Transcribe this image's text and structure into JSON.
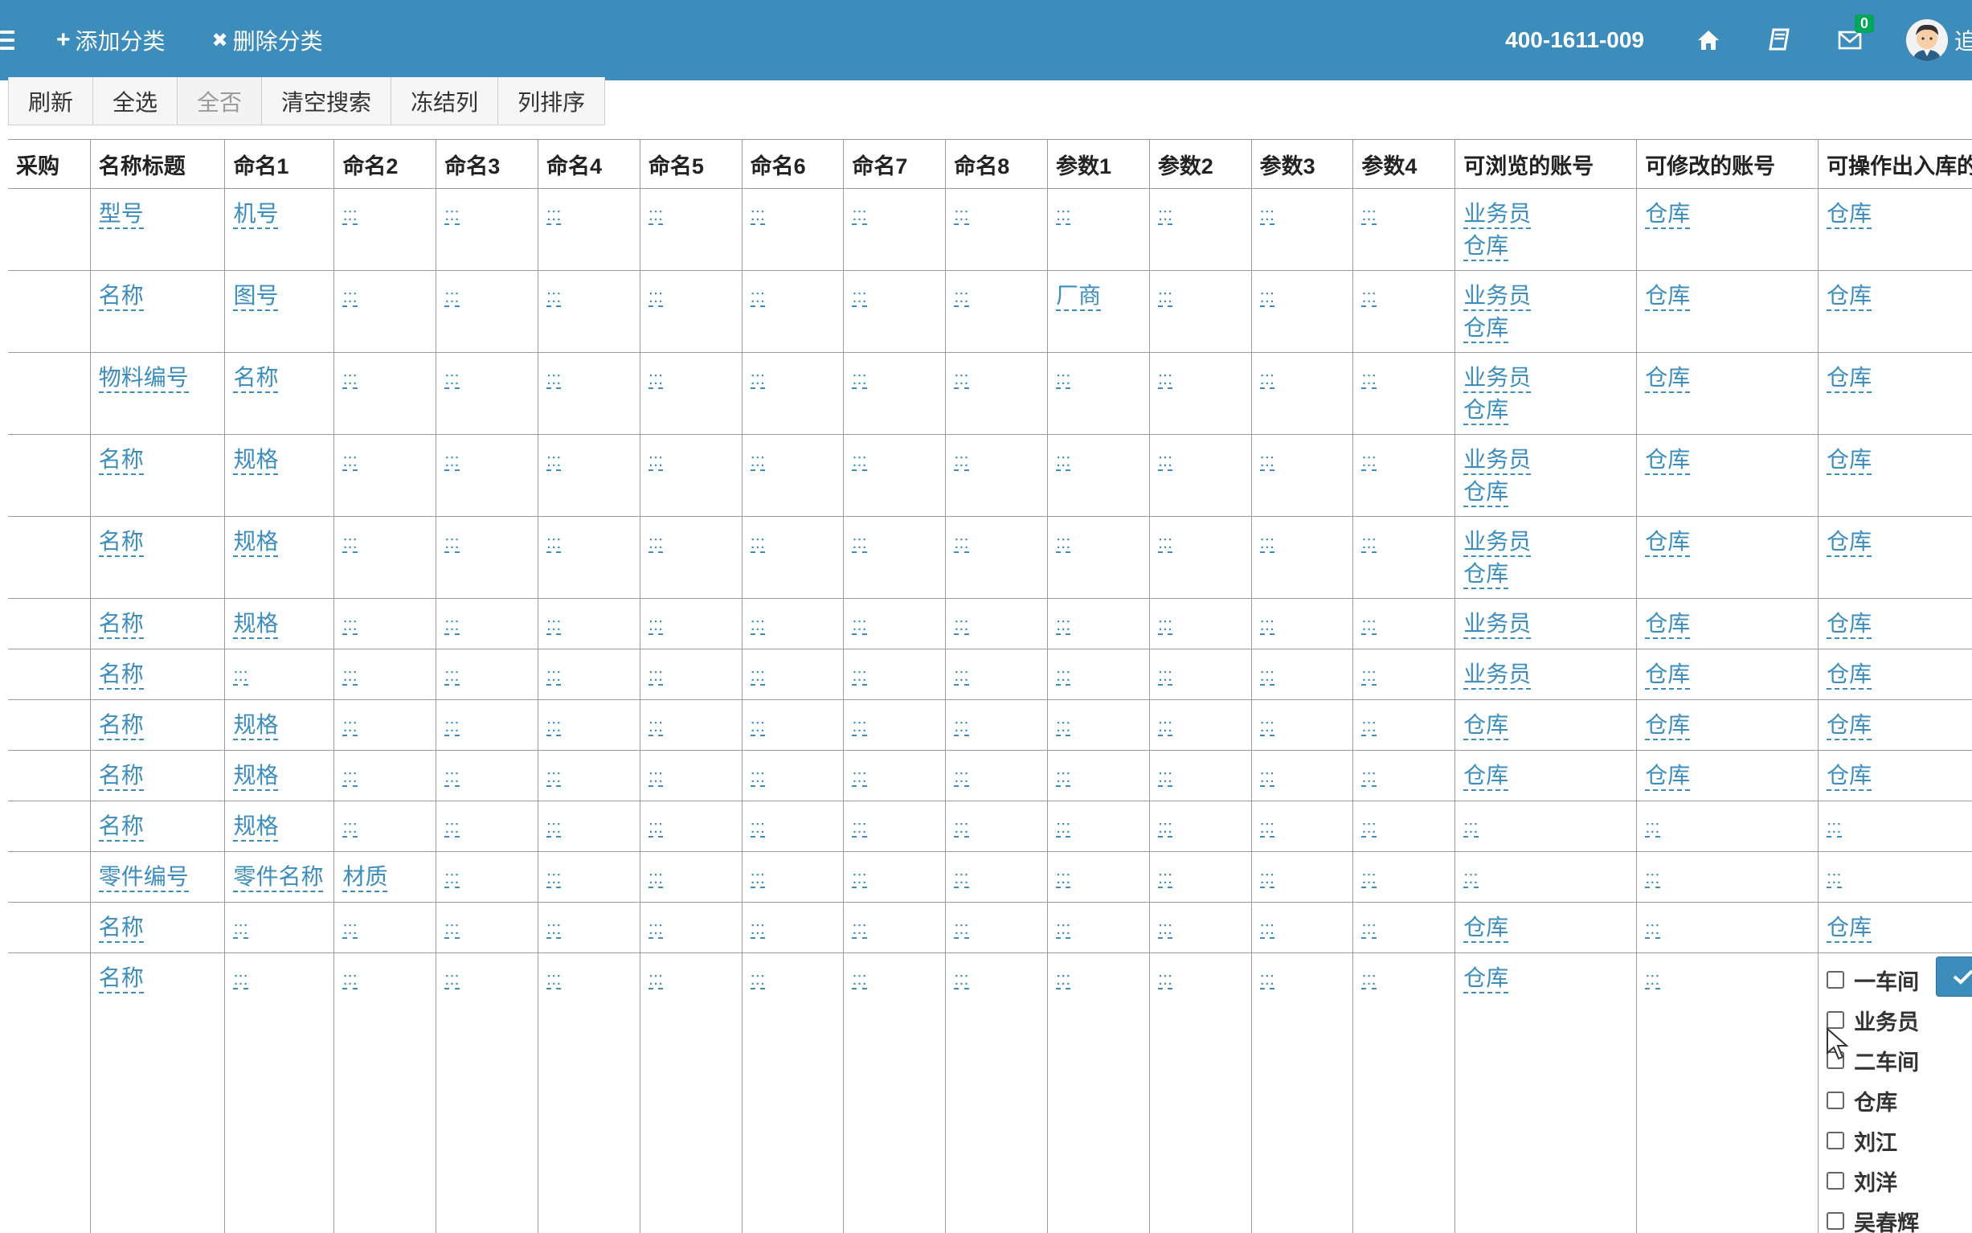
{
  "topbar": {
    "add_category": "添加分类",
    "add_icon": "+",
    "delete_category": "删除分类",
    "delete_icon": "✖",
    "phone": "400-1611-009",
    "mail_badge": "0",
    "user_name_fragment": "追"
  },
  "toolbar": {
    "refresh": "刷新",
    "select_all": "全选",
    "select_none": "全否",
    "clear_search": "清空搜索",
    "freeze_columns": "冻结列",
    "sort_columns": "列排序"
  },
  "grid": {
    "columns": [
      "采购",
      "名称标题",
      "命名1",
      "命名2",
      "命名3",
      "命名4",
      "命名5",
      "命名6",
      "命名7",
      "命名8",
      "参数1",
      "参数2",
      "参数3",
      "参数4",
      "可浏览的账号",
      "可修改的账号",
      "可操作出入库的账号"
    ],
    "placeholder": ":::",
    "rows": [
      [
        "",
        "型号",
        "机号",
        ":::",
        ":::",
        ":::",
        ":::",
        ":::",
        ":::",
        ":::",
        ":::",
        ":::",
        ":::",
        ":::",
        [
          "业务员",
          "仓库"
        ],
        "仓库",
        "仓库"
      ],
      [
        "",
        "名称",
        "图号",
        ":::",
        ":::",
        ":::",
        ":::",
        ":::",
        ":::",
        ":::",
        "厂商",
        ":::",
        ":::",
        ":::",
        [
          "业务员",
          "仓库"
        ],
        "仓库",
        "仓库"
      ],
      [
        "",
        "物料编号",
        "名称",
        ":::",
        ":::",
        ":::",
        ":::",
        ":::",
        ":::",
        ":::",
        ":::",
        ":::",
        ":::",
        ":::",
        [
          "业务员",
          "仓库"
        ],
        "仓库",
        "仓库"
      ],
      [
        "",
        "名称",
        "规格",
        ":::",
        ":::",
        ":::",
        ":::",
        ":::",
        ":::",
        ":::",
        ":::",
        ":::",
        ":::",
        ":::",
        [
          "业务员",
          "仓库"
        ],
        "仓库",
        "仓库"
      ],
      [
        "",
        "名称",
        "规格",
        ":::",
        ":::",
        ":::",
        ":::",
        ":::",
        ":::",
        ":::",
        ":::",
        ":::",
        ":::",
        ":::",
        [
          "业务员",
          "仓库"
        ],
        "仓库",
        "仓库"
      ],
      [
        "",
        "名称",
        "规格",
        ":::",
        ":::",
        ":::",
        ":::",
        ":::",
        ":::",
        ":::",
        ":::",
        ":::",
        ":::",
        ":::",
        "业务员",
        "仓库",
        "仓库"
      ],
      [
        "",
        "名称",
        ":::",
        ":::",
        ":::",
        ":::",
        ":::",
        ":::",
        ":::",
        ":::",
        ":::",
        ":::",
        ":::",
        ":::",
        "业务员",
        "仓库",
        "仓库"
      ],
      [
        "",
        "名称",
        "规格",
        ":::",
        ":::",
        ":::",
        ":::",
        ":::",
        ":::",
        ":::",
        ":::",
        ":::",
        ":::",
        ":::",
        "仓库",
        "仓库",
        "仓库"
      ],
      [
        "",
        "名称",
        "规格",
        ":::",
        ":::",
        ":::",
        ":::",
        ":::",
        ":::",
        ":::",
        ":::",
        ":::",
        ":::",
        ":::",
        "仓库",
        "仓库",
        "仓库"
      ],
      [
        "",
        "名称",
        "规格",
        ":::",
        ":::",
        ":::",
        ":::",
        ":::",
        ":::",
        ":::",
        ":::",
        ":::",
        ":::",
        ":::",
        ":::",
        ":::",
        ":::"
      ],
      [
        "",
        "零件编号",
        "零件名称",
        "材质",
        ":::",
        ":::",
        ":::",
        ":::",
        ":::",
        ":::",
        ":::",
        ":::",
        ":::",
        ":::",
        ":::",
        ":::",
        ":::"
      ],
      [
        "",
        "名称",
        ":::",
        ":::",
        ":::",
        ":::",
        ":::",
        ":::",
        ":::",
        ":::",
        ":::",
        ":::",
        ":::",
        ":::",
        "仓库",
        ":::",
        "仓库"
      ],
      [
        "",
        "名称",
        ":::",
        ":::",
        ":::",
        ":::",
        ":::",
        ":::",
        ":::",
        ":::",
        ":::",
        ":::",
        ":::",
        ":::",
        "仓库",
        ":::",
        ""
      ]
    ],
    "row_heights": [
      "tall",
      "tall",
      "tall",
      "tall",
      "tall",
      "short",
      "short",
      "short",
      "short",
      "short",
      "short",
      "short",
      "last"
    ]
  },
  "editor": {
    "options": [
      "一车间",
      "业务员",
      "二车间",
      "仓库",
      "刘江",
      "刘洋",
      "吴春辉"
    ],
    "confirm_icon": "check-icon"
  },
  "colors": {
    "topbar": "#3c8dbc",
    "link": "#3c8dbc",
    "badge": "#00a65a"
  }
}
